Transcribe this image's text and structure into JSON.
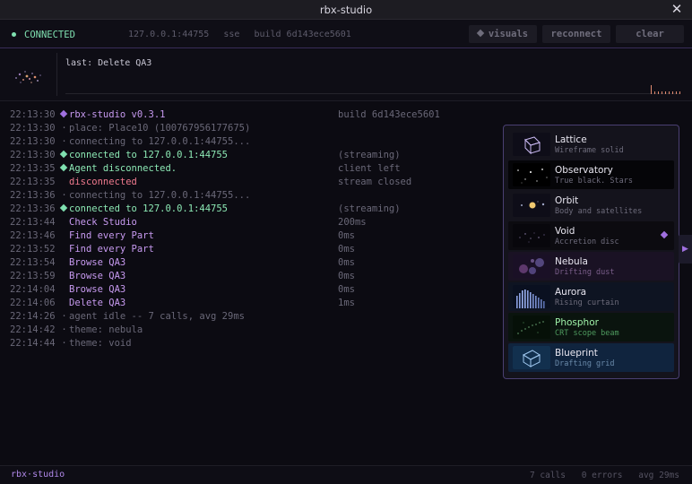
{
  "window": {
    "title": "rbx-studio"
  },
  "toolbar": {
    "status": "CONNECTED",
    "address": "127.0.0.1:44755",
    "transport": "sse",
    "build": "build 6d143ece5601",
    "visuals_label": "visuals",
    "reconnect_label": "reconnect",
    "clear_label": "clear"
  },
  "top": {
    "last": "last: Delete QA3"
  },
  "log": [
    {
      "ts": "22:13:30",
      "marker": "diamond-purple",
      "text": "rbx-studio v0.3.1",
      "tone": "purple",
      "extra": "build 6d143ece5601"
    },
    {
      "ts": "22:13:30",
      "marker": "dot",
      "text": "place: Place10 (100767956177675)",
      "tone": "gray",
      "extra": ""
    },
    {
      "ts": "22:13:30",
      "marker": "dot",
      "text": "connecting to 127.0.0.1:44755...",
      "tone": "gray",
      "extra": ""
    },
    {
      "ts": "22:13:30",
      "marker": "diamond-green",
      "text": "connected to 127.0.0.1:44755",
      "tone": "green",
      "extra": "(streaming)"
    },
    {
      "ts": "22:13:35",
      "marker": "diamond-green",
      "text": "Agent disconnected.",
      "tone": "green",
      "extra": "client left"
    },
    {
      "ts": "22:13:35",
      "marker": "",
      "text": "disconnected",
      "tone": "red",
      "extra": "stream closed"
    },
    {
      "ts": "22:13:36",
      "marker": "dot",
      "text": "connecting to 127.0.0.1:44755...",
      "tone": "gray",
      "extra": ""
    },
    {
      "ts": "22:13:36",
      "marker": "diamond-green",
      "text": "connected to 127.0.0.1:44755",
      "tone": "green",
      "extra": "(streaming)"
    },
    {
      "ts": "22:13:44",
      "marker": "",
      "text": "Check Studio",
      "tone": "purple",
      "extra": "200ms"
    },
    {
      "ts": "22:13:46",
      "marker": "",
      "text": "Find every Part",
      "tone": "purple",
      "extra": "0ms"
    },
    {
      "ts": "22:13:52",
      "marker": "",
      "text": "Find every Part",
      "tone": "purple",
      "extra": "0ms"
    },
    {
      "ts": "22:13:54",
      "marker": "",
      "text": "Browse QA3",
      "tone": "purple",
      "extra": "0ms"
    },
    {
      "ts": "22:13:59",
      "marker": "",
      "text": "Browse QA3",
      "tone": "purple",
      "extra": "0ms"
    },
    {
      "ts": "22:14:04",
      "marker": "",
      "text": "Browse QA3",
      "tone": "purple",
      "extra": "0ms"
    },
    {
      "ts": "22:14:06",
      "marker": "",
      "text": "Delete QA3",
      "tone": "purple",
      "extra": "1ms"
    },
    {
      "ts": "22:14:26",
      "marker": "dot",
      "text": "agent idle -- 7 calls, avg 29ms",
      "tone": "gray",
      "extra": ""
    },
    {
      "ts": "22:14:42",
      "marker": "dot",
      "text": "theme: nebula",
      "tone": "gray",
      "extra": ""
    },
    {
      "ts": "22:14:44",
      "marker": "dot",
      "text": "theme: void",
      "tone": "gray",
      "extra": ""
    }
  ],
  "visuals_menu": {
    "selected": "Void",
    "items": [
      {
        "key": "lattice",
        "name": "Lattice",
        "desc": "Wireframe solid",
        "icon": "cube-wireframe-icon"
      },
      {
        "key": "observatory",
        "name": "Observatory",
        "desc": "True black. Stars",
        "icon": "stars-icon"
      },
      {
        "key": "orbit",
        "name": "Orbit",
        "desc": "Body and satellites",
        "icon": "orbit-icon"
      },
      {
        "key": "void",
        "name": "Void",
        "desc": "Accretion disc",
        "icon": "accretion-disc-icon"
      },
      {
        "key": "nebula",
        "name": "Nebula",
        "desc": "Drifting dust",
        "icon": "nebula-icon"
      },
      {
        "key": "aurora",
        "name": "Aurora",
        "desc": "Rising curtain",
        "icon": "aurora-icon"
      },
      {
        "key": "phosphor",
        "name": "Phosphor",
        "desc": "CRT scope beam",
        "icon": "scope-beam-icon"
      },
      {
        "key": "blueprint",
        "name": "Blueprint",
        "desc": "Drafting grid",
        "icon": "blueprint-cube-icon"
      }
    ]
  },
  "footer": {
    "brand": "rbx·studio",
    "calls": "7 calls",
    "errors": "0 errors",
    "avg": "avg 29ms"
  },
  "colors": {
    "accent": "#a070e0",
    "connected": "#7fe0b0",
    "error": "#f07a8e",
    "tool": "#c79af0"
  }
}
